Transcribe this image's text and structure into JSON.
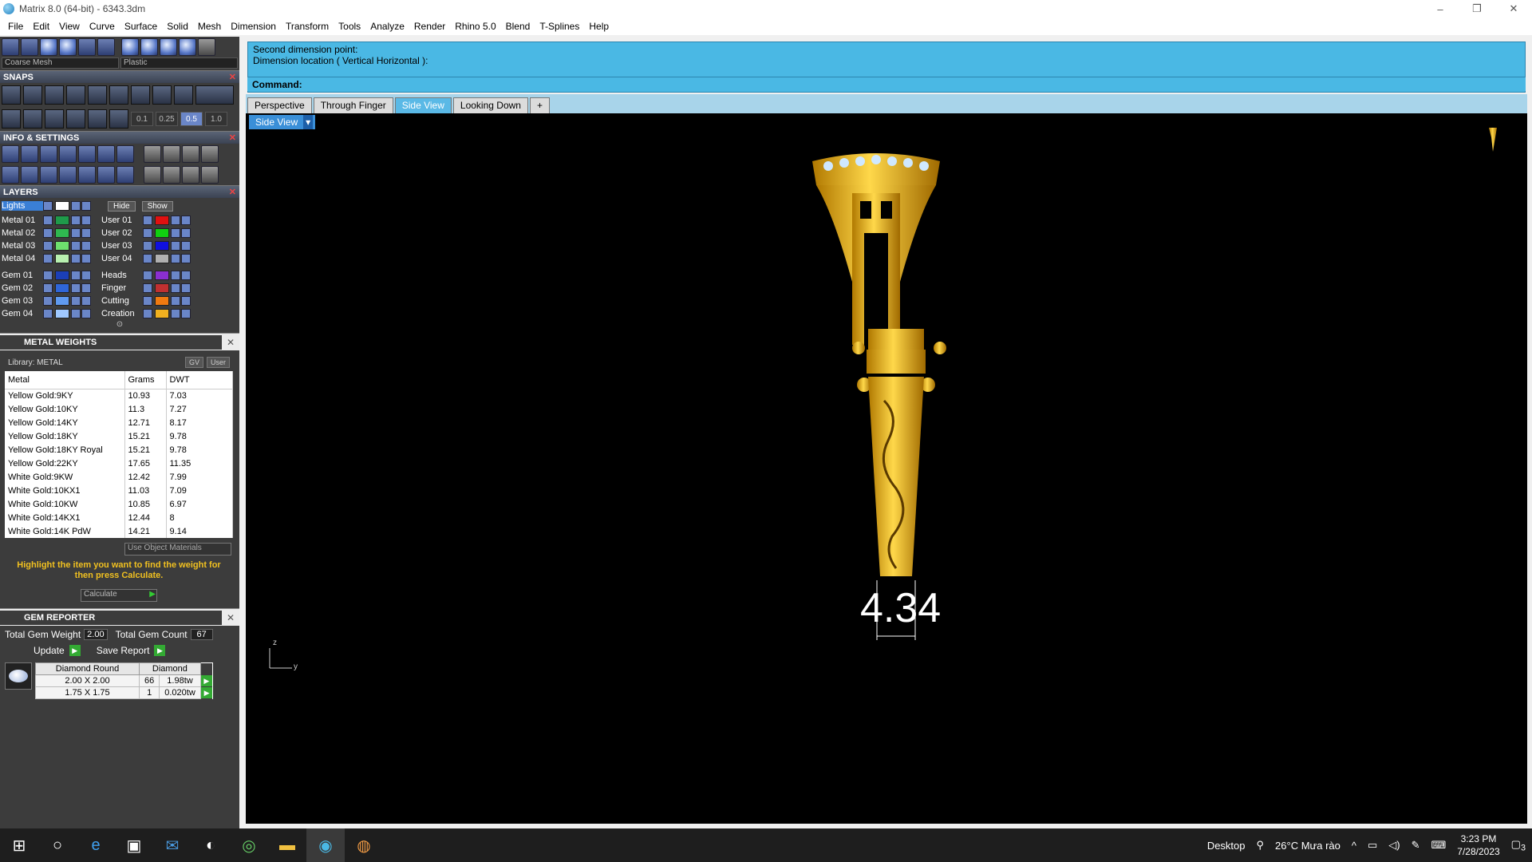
{
  "window": {
    "title": "Matrix 8.0 (64-bit) - 6343.3dm",
    "minimize": "–",
    "restore": "❐",
    "close": "✕"
  },
  "menu": [
    "File",
    "Edit",
    "View",
    "Curve",
    "Surface",
    "Solid",
    "Mesh",
    "Dimension",
    "Transform",
    "Tools",
    "Analyze",
    "Render",
    "Rhino 5.0",
    "Blend",
    "T-Splines",
    "Help"
  ],
  "toolbar": {
    "mesh_select": "Coarse Mesh",
    "material_select": "Plastic"
  },
  "sections": {
    "snaps": "SNAPS",
    "info": "INFO & SETTINGS",
    "layers": "LAYERS",
    "metal_weights": "METAL WEIGHTS",
    "gem_reporter": "GEM REPORTER"
  },
  "snaps": {
    "values": [
      "0.1",
      "0.25",
      "0.5",
      "1.0"
    ]
  },
  "layers": {
    "lights": "Lights",
    "hide": "Hide",
    "show": "Show",
    "left": [
      {
        "name": "Metal 01",
        "color": "#1f9a4a"
      },
      {
        "name": "Metal 02",
        "color": "#2fb850"
      },
      {
        "name": "Metal 03",
        "color": "#6ee06e"
      },
      {
        "name": "Metal 04",
        "color": "#b8f0b0"
      },
      {
        "name": "Gem 01",
        "color": "#1b3fb8"
      },
      {
        "name": "Gem 02",
        "color": "#2f66d8"
      },
      {
        "name": "Gem 03",
        "color": "#5f9af0"
      },
      {
        "name": "Gem 04",
        "color": "#9fc8ff"
      }
    ],
    "right": [
      {
        "name": "User 01",
        "color": "#e01010"
      },
      {
        "name": "User 02",
        "color": "#10d010"
      },
      {
        "name": "User 03",
        "color": "#1010e0"
      },
      {
        "name": "User 04",
        "color": "#b0b0b0"
      },
      {
        "name": "Heads",
        "color": "#8a2fd0"
      },
      {
        "name": "Finger",
        "color": "#c03030"
      },
      {
        "name": "Cutting",
        "color": "#f07a10"
      },
      {
        "name": "Creation",
        "color": "#f0b020"
      }
    ]
  },
  "metal_weights": {
    "library": "Library: METAL",
    "btn_gv": "GV",
    "btn_user": "User",
    "columns": [
      "Metal",
      "Grams",
      "DWT"
    ],
    "rows": [
      [
        "Yellow Gold:9KY",
        "10.93",
        "7.03"
      ],
      [
        "Yellow Gold:10KY",
        "11.3",
        "7.27"
      ],
      [
        "Yellow Gold:14KY",
        "12.71",
        "8.17"
      ],
      [
        "Yellow Gold:18KY",
        "15.21",
        "9.78"
      ],
      [
        "Yellow Gold:18KY Royal",
        "15.21",
        "9.78"
      ],
      [
        "Yellow Gold:22KY",
        "17.65",
        "11.35"
      ],
      [
        "White Gold:9KW",
        "12.42",
        "7.99"
      ],
      [
        "White Gold:10KX1",
        "11.03",
        "7.09"
      ],
      [
        "White Gold:10KW",
        "10.85",
        "6.97"
      ],
      [
        "White Gold:14KX1",
        "12.44",
        "8"
      ],
      [
        "White Gold:14K PdW",
        "14.21",
        "9.14"
      ]
    ],
    "use_object_materials": "Use Object Materials",
    "hint": "Highlight the item you want to find the weight for then press Calculate.",
    "calculate": "Calculate"
  },
  "gem_reporter": {
    "total_weight_label": "Total Gem Weight",
    "total_weight": "2.00",
    "total_count_label": "Total Gem Count",
    "total_count": "67",
    "update": "Update",
    "save_report": "Save Report",
    "headers": [
      "Diamond Round",
      "Diamond"
    ],
    "rows": [
      [
        "2.00 X 2.00",
        "66",
        "1.98tw"
      ],
      [
        "1.75 X 1.75",
        "1",
        "0.020tw"
      ]
    ]
  },
  "command": {
    "line1": "Second dimension point:",
    "line2": "Dimension location ( Vertical  Horizontal ):",
    "prompt": "Command:"
  },
  "viewport": {
    "tabs": [
      "Perspective",
      "Through Finger",
      "Side View",
      "Looking Down",
      "+"
    ],
    "active_tab": "Side View",
    "label": "Side View",
    "dimension": "4.34",
    "axis_z": "z",
    "axis_y": "y"
  },
  "taskbar": {
    "desktop": "Desktop",
    "weather": "26°C  Mưa rào",
    "time": "3:23 PM",
    "date": "7/28/2023",
    "notif_count": "3"
  }
}
